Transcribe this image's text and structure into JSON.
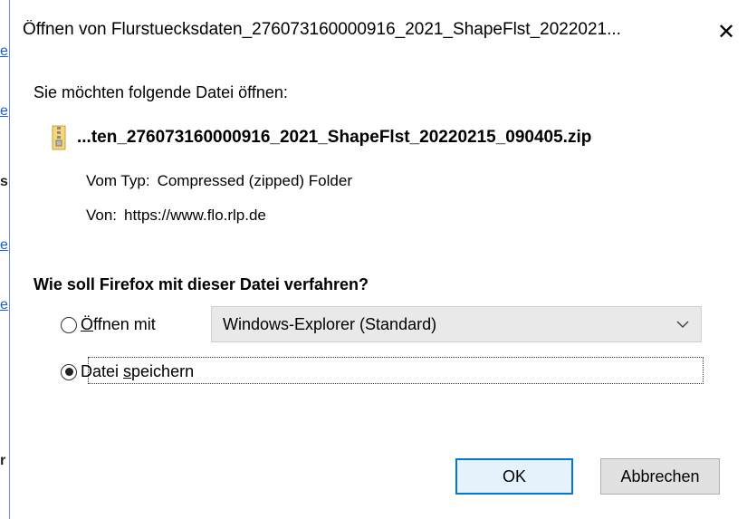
{
  "dialog": {
    "title": "Öffnen von Flurstuecksdaten_276073160000916_2021_ShapeFlst_2022021...",
    "close_glyph": "✕",
    "prompt": "Sie möchten folgende Datei öffnen:",
    "file_name": "...ten_276073160000916_2021_ShapeFlst_20220215_090405.zip",
    "type_label": "Vom Typ:",
    "type_value": "Compressed (zipped) Folder",
    "from_label": "Von:",
    "from_value": "https://www.flo.rlp.de",
    "question": "Wie soll Firefox mit dieser Datei verfahren?",
    "open_with": {
      "label_accel": "Ö",
      "label_rest": "ffnen mit",
      "selected": false,
      "app": "Windows-Explorer (Standard)"
    },
    "save_file": {
      "label_pre": "Datei ",
      "label_accel": "s",
      "label_rest": "peichern",
      "selected": true
    },
    "ok_label": "OK",
    "cancel_label": "Abbrechen"
  },
  "colors": {
    "accent": "#0078d7",
    "window_border": "#6b8fc4",
    "link": "#1a5fd6"
  }
}
